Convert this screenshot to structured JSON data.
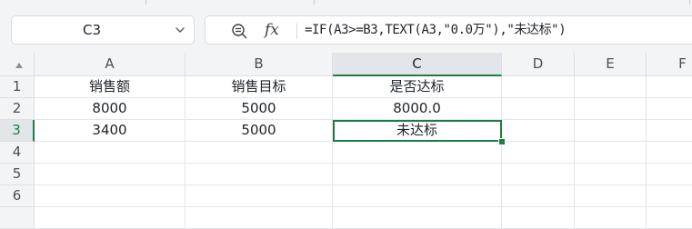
{
  "name_box": {
    "value": "C3"
  },
  "formula_bar": {
    "fx_label": "fx",
    "formula": "=IF(A3>=B3,TEXT(A3,\"0.0万\"),\"未达标\")"
  },
  "columns": [
    "A",
    "B",
    "C",
    "D",
    "E",
    "F"
  ],
  "rows": [
    "1",
    "2",
    "3",
    "4",
    "5",
    "6"
  ],
  "active_cell": {
    "column": "C",
    "row": "3"
  },
  "cells": {
    "A1": "销售额",
    "B1": "销售目标",
    "C1": "是否达标",
    "A2": "8000",
    "B2": "5000",
    "C2": "8000.0",
    "A3": "3400",
    "B3": "5000",
    "C3": "未达标"
  },
  "colors": {
    "accent": "#1a7f45",
    "header_bg": "#f3f4f6",
    "grid": "#e3e5e8"
  },
  "icons": {
    "zoom": "zoom-formula-icon",
    "dropdown": "chevron-down-icon",
    "select_all": "select-all-triangle-icon"
  }
}
